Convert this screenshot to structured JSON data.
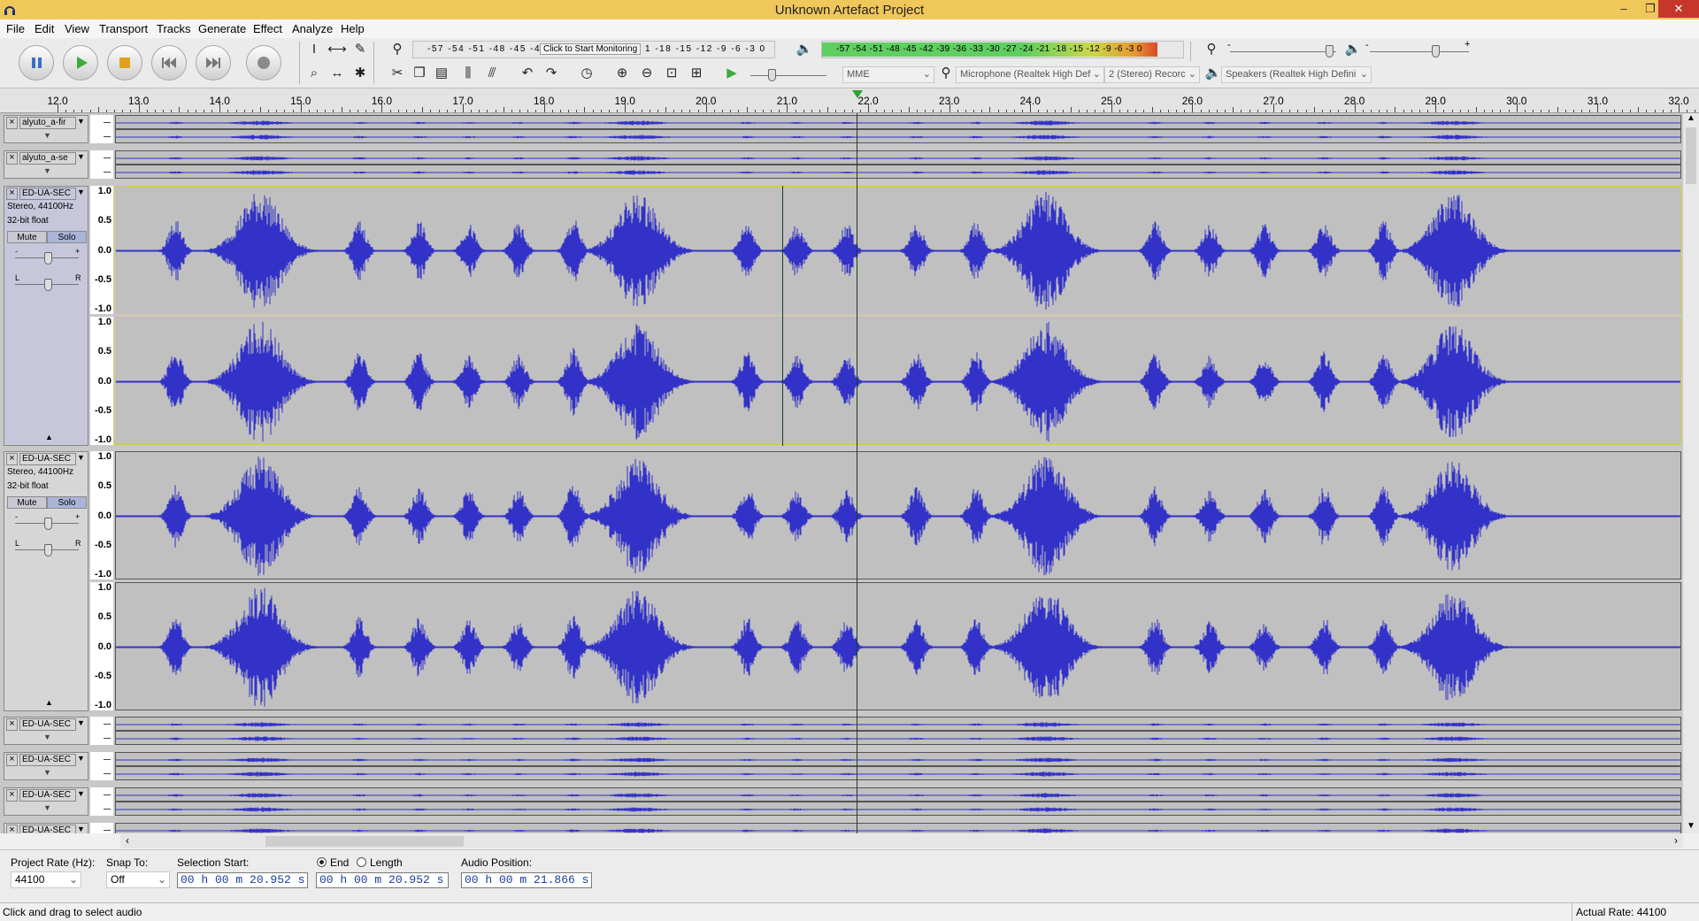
{
  "window": {
    "title": "Unknown Artefact Project",
    "minimize": "–",
    "maximize": "❐",
    "close": "✕"
  },
  "menu": [
    "File",
    "Edit",
    "View",
    "Transport",
    "Tracks",
    "Generate",
    "Effect",
    "Analyze",
    "Help"
  ],
  "meters": {
    "record_ticks": "-57 -54 -51 -48 -45 -42 -3",
    "monitor_hint": "Click to Start Monitoring",
    "record_ticks_tail": "1 -18 -15 -12 -9 -6 -3 0",
    "play_ticks": "-57 -54 -51 -48 -45 -42 -39 -36 -33 -30 -27 -24 -21 -18 -15 -12 -9 -6 -3 0",
    "play_level_fraction": 0.93
  },
  "devices": {
    "host": "MME",
    "microphone": "Microphone (Realtek High Def",
    "channels": "2 (Stereo) Recorc",
    "speakers": "Speakers (Realtek High Defini"
  },
  "ruler": {
    "labels": [
      "12.0",
      "13.0",
      "14.0",
      "15.0",
      "16.0",
      "17.0",
      "18.0",
      "19.0",
      "20.0",
      "21.0",
      "22.0",
      "23.0",
      "24.0",
      "25.0",
      "26.0",
      "27.0",
      "28.0",
      "29.0",
      "30.0",
      "31.0",
      "32.0"
    ]
  },
  "tracks": [
    {
      "name": "alyuto_a-fir",
      "collapsed": true
    },
    {
      "name": "alyuto_a-se",
      "collapsed": true
    },
    {
      "name": "ED-UA-SEC",
      "info1": "Stereo, 44100Hz",
      "info2": "32-bit float",
      "mute": "Mute",
      "solo": "Solo",
      "selected": true
    },
    {
      "name": "ED-UA-SEC",
      "info1": "Stereo, 44100Hz",
      "info2": "32-bit float",
      "mute": "Mute",
      "solo": "Solo",
      "selected": false
    },
    {
      "name": "ED-UA-SEC",
      "collapsed": true
    },
    {
      "name": "ED-UA-SEC",
      "collapsed": true
    },
    {
      "name": "ED-UA-SEC",
      "collapsed": true
    },
    {
      "name": "ED-UA-SEC",
      "collapsed": true
    }
  ],
  "vscale": [
    "1.0",
    "0.5",
    "0.0",
    "-0.5",
    "-1.0"
  ],
  "gain": {
    "minus": "-",
    "plus": "+",
    "L": "L",
    "R": "R"
  },
  "colors": {
    "waveform": "#3232c8",
    "wave_bg": "#c0c0c0",
    "titlebar": "#f0c75a"
  },
  "selection": {
    "project_rate_label": "Project Rate (Hz):",
    "project_rate": "44100",
    "snap_to_label": "Snap To:",
    "snap_to": "Off",
    "selection_start_label": "Selection Start:",
    "end_label": "End",
    "length_label": "Length",
    "audio_position_label": "Audio Position:",
    "start_time": "00 h 00 m 20.952 s",
    "end_time": "00 h 00 m 20.952 s",
    "audio_position": "00 h 00 m 21.866 s"
  },
  "status": {
    "left": "Click and drag to select audio",
    "right": "Actual Rate: 44100"
  }
}
